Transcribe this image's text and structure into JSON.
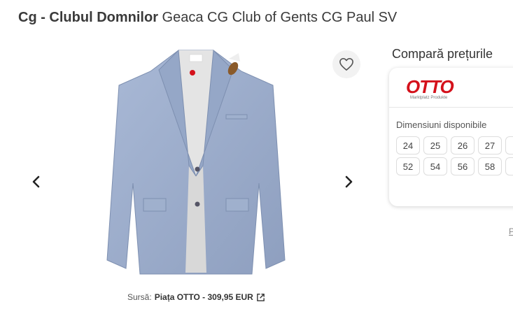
{
  "header": {
    "brand": "Cg - Clubul Domnilor",
    "product": "Geaca CG Club of Gents CG Paul SV"
  },
  "gallery": {
    "prev_icon": "chevron-left-icon",
    "next_icon": "chevron-right-icon",
    "favorite_icon": "heart-outline-icon",
    "image_desc": "light blue jacket product photo"
  },
  "source": {
    "label": "Sursă:",
    "value": "Piața OTTO - 309,95 EUR",
    "icon": "external-link-icon"
  },
  "compare": {
    "title": "Compară prețurile",
    "shop": {
      "logo_text": "OTTO",
      "logo_sub": "Marktplatz Produkte",
      "logo_color": "#d4111b",
      "sizes_label": "Dimensiuni disponibile",
      "sizes": [
        "24",
        "25",
        "26",
        "27",
        "",
        "52",
        "54",
        "56",
        "58",
        ""
      ]
    },
    "peek_text": "P"
  }
}
